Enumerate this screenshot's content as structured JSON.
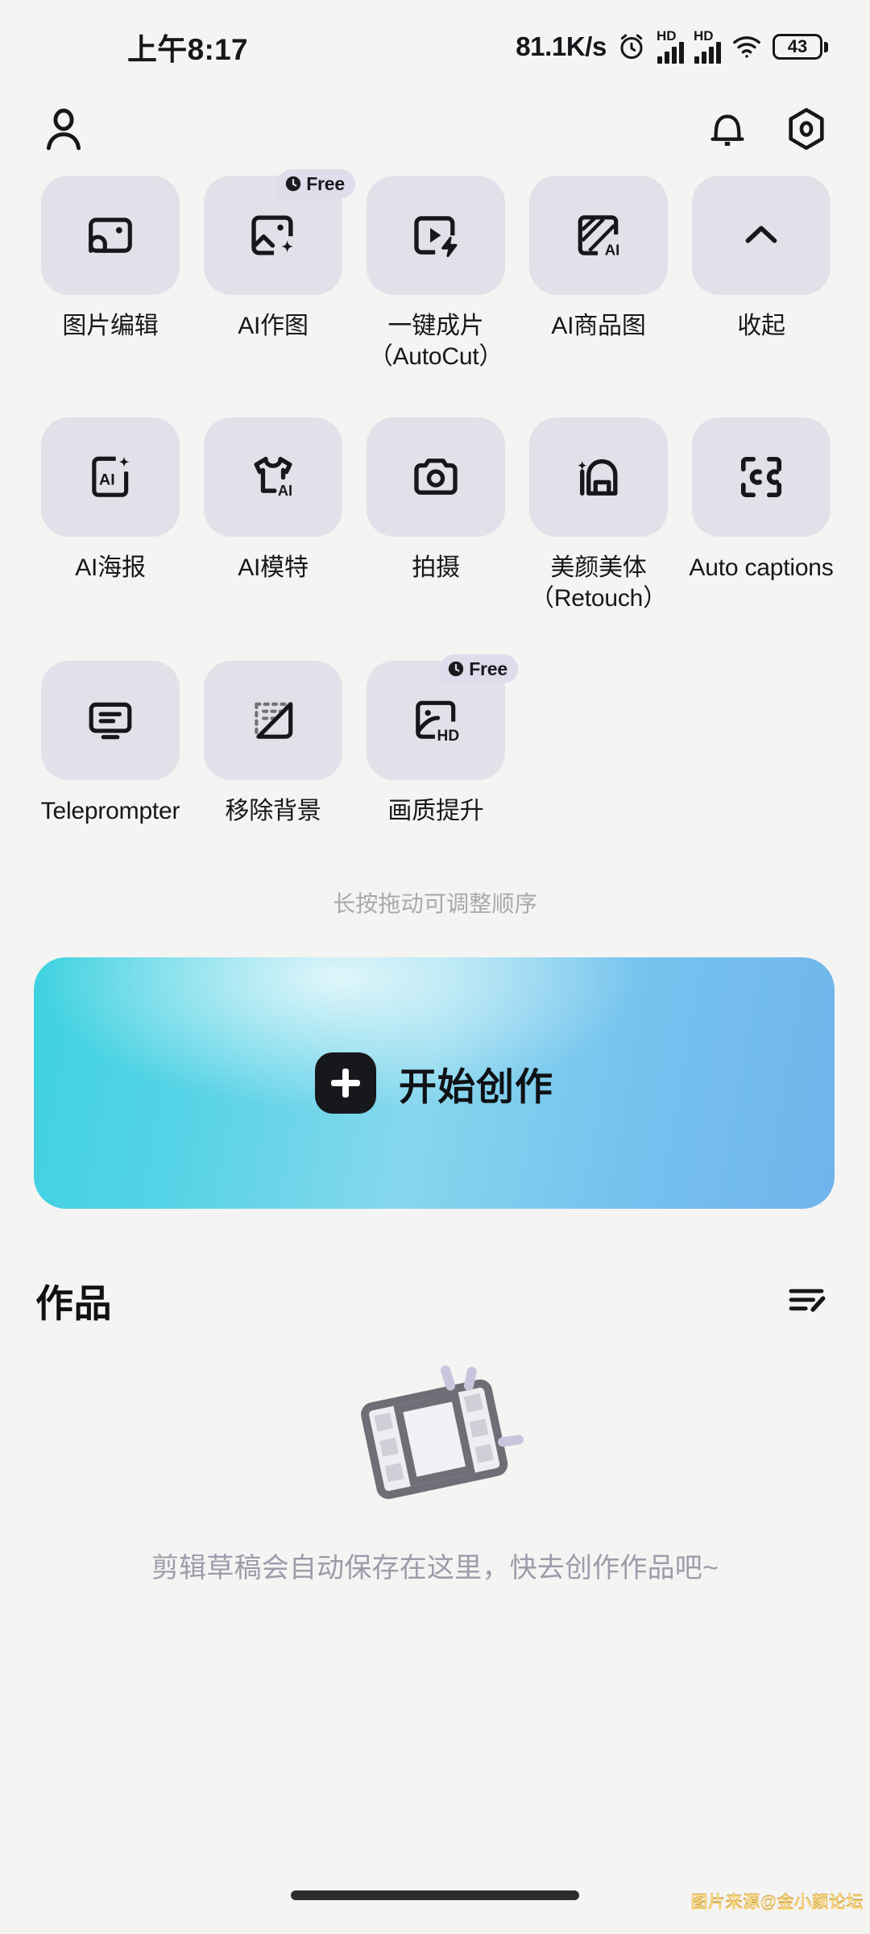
{
  "status_bar": {
    "time": "上午8:17",
    "net_speed": "81.1K/s",
    "alarm_icon": "alarm-clock-icon",
    "signal_1_label": "HD",
    "signal_2_label": "HD",
    "wifi_icon": "wifi-icon",
    "battery_level": "43"
  },
  "top_nav": {
    "profile_icon": "person-icon",
    "bell_icon": "bell-icon",
    "settings_icon": "hexagon-settings-icon"
  },
  "tools": {
    "drag_hint": "长按拖动可调整顺序",
    "items": [
      {
        "label": "图片编辑",
        "icon": "image-edit-icon",
        "badge": null
      },
      {
        "label": "AI作图",
        "icon": "ai-image-sparkle-icon",
        "badge": "Free"
      },
      {
        "label": "一键成片\n（AutoCut）",
        "icon": "auto-cut-bolt-icon",
        "badge": null
      },
      {
        "label": "AI商品图",
        "icon": "ai-product-image-icon",
        "badge": null
      },
      {
        "label": "收起",
        "icon": "chevron-up-icon",
        "badge": null
      },
      {
        "label": "AI海报",
        "icon": "ai-poster-icon",
        "badge": null
      },
      {
        "label": "AI模特",
        "icon": "ai-model-shirt-icon",
        "badge": null
      },
      {
        "label": "拍摄",
        "icon": "camera-icon",
        "badge": null
      },
      {
        "label": "美颜美体\n（Retouch）",
        "icon": "retouch-face-icon",
        "badge": null
      },
      {
        "label": "Auto captions",
        "icon": "closed-caption-icon",
        "badge": null
      },
      {
        "label": "Teleprompter",
        "icon": "teleprompter-icon",
        "badge": null
      },
      {
        "label": "移除背景",
        "icon": "remove-background-icon",
        "badge": null
      },
      {
        "label": "画质提升",
        "icon": "hd-enhance-icon",
        "badge": "Free"
      }
    ]
  },
  "cta": {
    "label": "开始创作",
    "plus_icon": "plus-icon",
    "gradient_start": "#3ED2E0",
    "gradient_end": "#6FB4EC"
  },
  "works": {
    "title": "作品",
    "manage_icon": "edit-list-icon",
    "empty_icon": "film-strip-icon",
    "empty_text": "剪辑草稿会自动保存在这里，快去创作作品吧~"
  },
  "watermark": {
    "text": "图片来源@金小颜论坛"
  },
  "colors": {
    "page_bg": "#F4F4F3",
    "tile_bg": "#E2E1E9",
    "badge_bg": "#DFDCEC",
    "text_primary": "#16171A",
    "text_muted": "#A9A9AE"
  }
}
